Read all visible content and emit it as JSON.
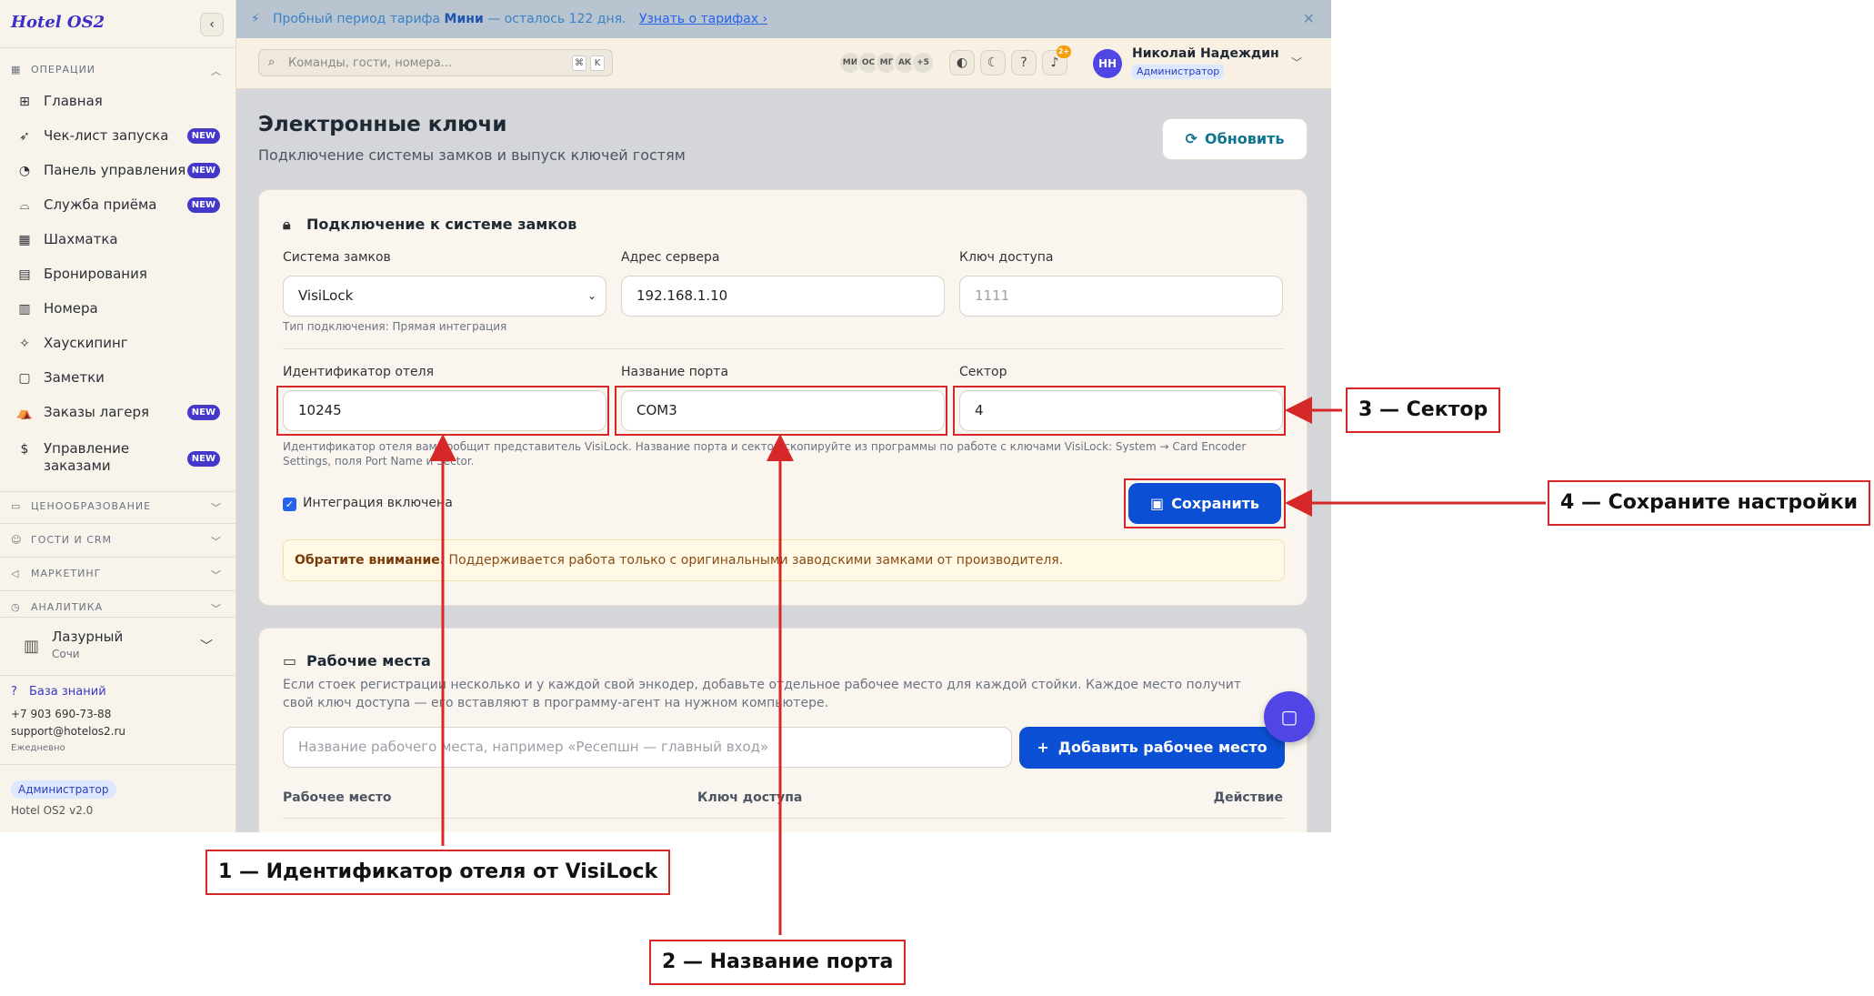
{
  "brand": "Hotel OS2",
  "banner": {
    "prefix": "Пробный период тарифа",
    "plan": "Мини",
    "suffix": "— осталось 122 дня.",
    "link": "Узнать о тарифах ›"
  },
  "search": {
    "placeholder": "Команды, гости, номера...",
    "key1": "⌘",
    "key2": "K"
  },
  "header": {
    "avatars": [
      "МИ",
      "ОС",
      "МГ",
      "АК",
      "+5"
    ],
    "notifications": "2+",
    "user_initials": "НН",
    "user_name": "Николай Надеждин",
    "user_role": "Администратор"
  },
  "sidebar": {
    "sections": {
      "operations": "ОПЕРАЦИИ",
      "pricing": "ЦЕНООБРАЗОВАНИЕ",
      "guests": "ГОСТИ И CRM",
      "marketing": "МАРКЕТИНГ",
      "analytics": "АНАЛИТИКА"
    },
    "items": [
      {
        "label": "Главная"
      },
      {
        "label": "Чек-лист запуска",
        "badge": "NEW"
      },
      {
        "label": "Панель управления",
        "badge": "NEW"
      },
      {
        "label": "Служба приёма",
        "badge": "NEW"
      },
      {
        "label": "Шахматка"
      },
      {
        "label": "Бронирования"
      },
      {
        "label": "Номера"
      },
      {
        "label": "Хаускипинг"
      },
      {
        "label": "Заметки"
      },
      {
        "label": "Заказы лагеря",
        "badge": "NEW"
      },
      {
        "label": "Управление заказами",
        "badge": "NEW"
      }
    ],
    "hotel": {
      "name": "Лазурный",
      "city": "Сочи"
    },
    "kb": "База знаний",
    "phone": "+7 903 690-73-88",
    "email": "support@hotelos2.ru",
    "schedule": "Ежедневно",
    "role": "Администратор",
    "version": "Hotel OS2 v2.0"
  },
  "page": {
    "title": "Электронные ключи",
    "subtitle": "Подключение системы замков и выпуск ключей гостям",
    "refresh": "Обновить"
  },
  "lock_card": {
    "title": "Подключение к системе замков",
    "lock_system_label": "Система замков",
    "lock_system_value": "VisiLock",
    "connection_type": "Тип подключения: Прямая интеграция",
    "server_label": "Адрес сервера",
    "server_value": "192.168.1.10",
    "key_label": "Ключ доступа",
    "key_placeholder": "1111",
    "hotel_id_label": "Идентификатор отеля",
    "hotel_id_value": "10245",
    "port_label": "Название порта",
    "port_value": "COM3",
    "sector_label": "Сектор",
    "sector_value": "4",
    "hint": "Идентификатор отеля вам сообщит представитель VisiLock. Название порта и сектор скопируйте из программы по работе с ключами VisiLock: System → Card Encoder Settings, поля Port Name и Sector.",
    "integration_enabled": "Интеграция включена",
    "save": "Сохранить",
    "notice_bold": "Обратите внимание.",
    "notice_text": "Поддерживается работа только с оригинальными заводскими замками от производителя."
  },
  "workplaces_card": {
    "title": "Рабочие места",
    "description": "Если стоек регистрации несколько и у каждой свой энкодер, добавьте отдельное рабочее место для каждой стойки. Каждое место получит свой ключ доступа — его вставляют в программу-агент на нужном компьютере.",
    "input_placeholder": "Название рабочего места, например «Ресепшн — главный вход»",
    "add_button": "Добавить рабочее место",
    "columns": [
      "Рабочее место",
      "Ключ доступа",
      "Действие"
    ]
  },
  "annotations": {
    "c1": "1 — Идентификатор отеля от VisiLock",
    "c2": "2 — Название порта",
    "c3": "3 — Сектор",
    "c4": "4 — Сохраните настройки"
  },
  "colors": {
    "accent": "#0b4fd4",
    "brand": "#3b2fc9",
    "annotation": "#d62828",
    "badge": "#4338ca"
  }
}
